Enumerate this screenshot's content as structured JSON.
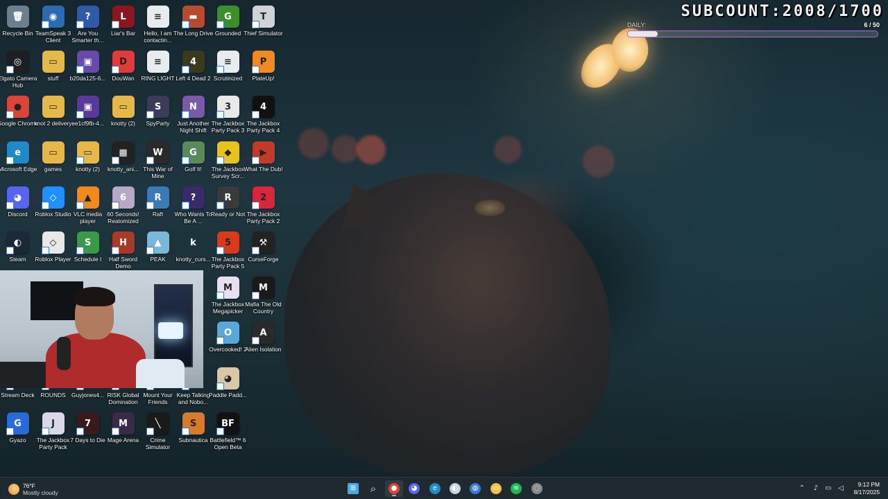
{
  "subcount": {
    "title": "SUBCOUNT:2008/1700",
    "daily_label": "DAILY:",
    "daily_count": "6 / 50",
    "daily_progress": 0.12
  },
  "icons": [
    {
      "label": "Recycle Bin",
      "glyph": "🗑",
      "color": "#6b7f8f",
      "shortcut": false
    },
    {
      "label": "TeamSpeak 3 Client",
      "glyph": "◉",
      "color": "#2b6cb0"
    },
    {
      "label": "Are You Smarter th...",
      "glyph": "?",
      "color": "#2f5aa8"
    },
    {
      "label": "Liar's Bar",
      "glyph": "L",
      "color": "#8a1620"
    },
    {
      "label": "Hello, I am contactin...",
      "glyph": "≡",
      "color": "#e9ecef",
      "shortcut": false
    },
    {
      "label": "The Long Drive",
      "glyph": "▬",
      "color": "#b84b2e"
    },
    {
      "label": "Grounded",
      "glyph": "G",
      "color": "#3b8f2a"
    },
    {
      "label": "Thief Simulator",
      "glyph": "T",
      "color": "#cfd3d6"
    },
    {
      "label": "Elgato Camera Hub",
      "glyph": "◎",
      "color": "#1d1f22"
    },
    {
      "label": "stuff",
      "glyph": "▭",
      "color": "#e6b84a",
      "shortcut": false
    },
    {
      "label": "b20da125-6...",
      "glyph": "▣",
      "color": "#6a4aa8"
    },
    {
      "label": "DouWan",
      "glyph": "D",
      "color": "#e23b3b"
    },
    {
      "label": "RING LIGHT",
      "glyph": "≡",
      "color": "#e9ecef",
      "shortcut": false
    },
    {
      "label": "Left 4 Dead 2",
      "glyph": "4",
      "color": "#3a3a1e"
    },
    {
      "label": "Scrutinized",
      "glyph": "≡",
      "color": "#e9ecef"
    },
    {
      "label": "PlateUp!",
      "glyph": "P",
      "color": "#f08a24"
    },
    {
      "label": "Google Chrome",
      "glyph": "●",
      "color": "#db4437"
    },
    {
      "label": "knot 2 delivery",
      "glyph": "▭",
      "color": "#e6b84a",
      "shortcut": false
    },
    {
      "label": "ee1cf9fb-4...",
      "glyph": "▣",
      "color": "#5a3a98"
    },
    {
      "label": "knotty (2)",
      "glyph": "▭",
      "color": "#e6b84a",
      "shortcut": false
    },
    {
      "label": "SpyParty",
      "glyph": "S",
      "color": "#3c3c5a"
    },
    {
      "label": "Just Another Night Shift",
      "glyph": "N",
      "color": "#7a5aa8"
    },
    {
      "label": "The Jackbox Party Pack 3",
      "glyph": "3",
      "color": "#e8e8e8"
    },
    {
      "label": "The Jackbox Party Pack 4",
      "glyph": "4",
      "color": "#111"
    },
    {
      "label": "Microsoft Edge",
      "glyph": "e",
      "color": "#1f8ac8"
    },
    {
      "label": "games",
      "glyph": "▭",
      "color": "#e6b84a",
      "shortcut": false
    },
    {
      "label": "knotty (2)",
      "glyph": "▭",
      "color": "#e6b84a"
    },
    {
      "label": "knotty_ani...",
      "glyph": "▦",
      "color": "#222"
    },
    {
      "label": "This War of Mine",
      "glyph": "W",
      "color": "#2a2a2a"
    },
    {
      "label": "Golf It!",
      "glyph": "G",
      "color": "#5a8a5a"
    },
    {
      "label": "The Jackbox Survey Scr...",
      "glyph": "◆",
      "color": "#e8c21e"
    },
    {
      "label": "What The Dub!",
      "glyph": "▶",
      "color": "#c23a2a"
    },
    {
      "label": "Discord",
      "glyph": "◕",
      "color": "#5865f2"
    },
    {
      "label": "Roblox Studio",
      "glyph": "◇",
      "color": "#1e90ff"
    },
    {
      "label": "VLC media player",
      "glyph": "▲",
      "color": "#f08a1a"
    },
    {
      "label": "60 Seconds! Reatomized",
      "glyph": "6",
      "color": "#b8a8c8"
    },
    {
      "label": "Raft",
      "glyph": "R",
      "color": "#3a7ab8"
    },
    {
      "label": "Who Wants To Be A ...",
      "glyph": "?",
      "color": "#3a2a6a"
    },
    {
      "label": "Ready or Not",
      "glyph": "R",
      "color": "#3a3a3a"
    },
    {
      "label": "The Jackbox Party Pack 2",
      "glyph": "2",
      "color": "#d8263a"
    },
    {
      "label": "Steam",
      "glyph": "◐",
      "color": "#1b2838"
    },
    {
      "label": "Roblox Player",
      "glyph": "◇",
      "color": "#e8e8e8"
    },
    {
      "label": "Schedule I",
      "glyph": "S",
      "color": "#3a9a4a"
    },
    {
      "label": "Half Sword Demo",
      "glyph": "H",
      "color": "#a83a2a"
    },
    {
      "label": "PEAK",
      "glyph": "▲",
      "color": "#7ab8d8"
    },
    {
      "label": "knotty_curs...",
      "glyph": "k",
      "color": "rgba(0,0,0,0)",
      "shortcut": false
    },
    {
      "label": "The Jackbox Party Pack 5",
      "glyph": "5",
      "color": "#d83a1a"
    },
    {
      "label": "CurseForge",
      "glyph": "⚒",
      "color": "#222"
    },
    {
      "label": "The Jackbox Megapicker",
      "glyph": "M",
      "color": "#e8e0f0"
    },
    {
      "label": "Mafia The Old Country",
      "glyph": "M",
      "color": "#1a1a1a"
    },
    {
      "label": "Overcooked! 2",
      "glyph": "O",
      "color": "#5aa8d8"
    },
    {
      "label": "Alien Isolation",
      "glyph": "A",
      "color": "#2a2a2a"
    },
    {
      "label": "Stream Deck",
      "glyph": "",
      "color": "rgba(0,0,0,0)"
    },
    {
      "label": "ROUNDS",
      "glyph": "",
      "color": "rgba(0,0,0,0)"
    },
    {
      "label": "Guyjones4...",
      "glyph": "",
      "color": "rgba(0,0,0,0)"
    },
    {
      "label": "RISK Global Domination",
      "glyph": "",
      "color": "rgba(0,0,0,0)"
    },
    {
      "label": "Mount Your Friends",
      "glyph": "",
      "color": "rgba(0,0,0,0)"
    },
    {
      "label": "Keep Talking and Nobo...",
      "glyph": "",
      "color": "rgba(0,0,0,0)"
    },
    {
      "label": "Paddle Padd...",
      "glyph": "◕",
      "color": "#d8c8a8"
    },
    {
      "label": "Gyazo",
      "glyph": "G",
      "color": "#2a6ad8"
    },
    {
      "label": "The Jackbox Party Pack",
      "glyph": "J",
      "color": "#d8d8e8"
    },
    {
      "label": "7 Days to Die",
      "glyph": "7",
      "color": "#3a1a1a"
    },
    {
      "label": "Mage Arena",
      "glyph": "M",
      "color": "#3a2a4a"
    },
    {
      "label": "Crime Simulator",
      "glyph": "╲",
      "color": "#1a1a1a"
    },
    {
      "label": "Subnautica",
      "glyph": "S",
      "color": "#d87a2a"
    },
    {
      "label": "Battlefield™ 6 Open Beta",
      "glyph": "BF",
      "color": "#111"
    }
  ],
  "taskbar": {
    "weather": {
      "temp": "76°F",
      "condition": "Mostly cloudy"
    },
    "apps": [
      {
        "name": "start-button",
        "color": "#4aa8e8",
        "glyph": "⊞"
      },
      {
        "name": "search-button",
        "color": "#e8e8e8",
        "glyph": "⌕"
      },
      {
        "name": "chrome-taskbar",
        "color": "#db4437",
        "glyph": "●",
        "active": true
      },
      {
        "name": "discord-taskbar",
        "color": "#5865f2",
        "glyph": "◕"
      },
      {
        "name": "edge-taskbar",
        "color": "#1f8ac8",
        "glyph": "e"
      },
      {
        "name": "steam-taskbar",
        "color": "#c7d5e0",
        "glyph": "◐"
      },
      {
        "name": "app-taskbar",
        "color": "#3a7ad8",
        "glyph": "◍"
      },
      {
        "name": "file-explorer-taskbar",
        "color": "#f0c04a",
        "glyph": "▭"
      },
      {
        "name": "spotify-taskbar",
        "color": "#1db954",
        "glyph": "≋"
      },
      {
        "name": "obs-taskbar",
        "color": "#8a8a8a",
        "glyph": "◌"
      }
    ],
    "time": "9:12 PM",
    "date": "8/17/2025"
  }
}
